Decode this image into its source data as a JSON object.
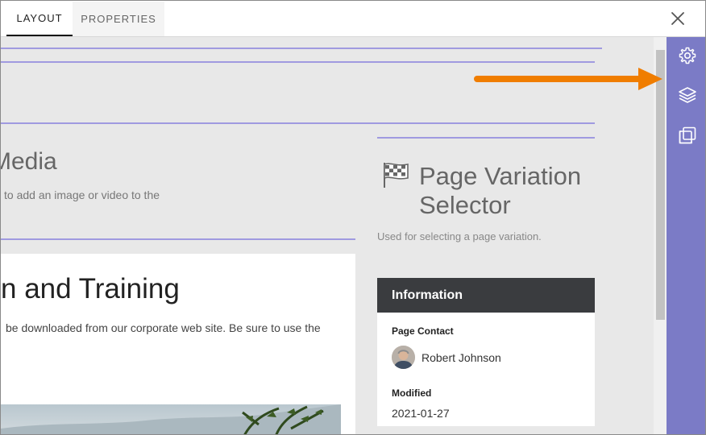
{
  "tabs": [
    {
      "label": "LAYOUT",
      "active": true
    },
    {
      "label": "PROPERTIES",
      "active": false
    }
  ],
  "header": {
    "close_icon": "close-icon"
  },
  "canvas": {
    "media": {
      "title": "Media",
      "description": "to add an image or video to the"
    },
    "page_variation": {
      "icon": "checkered-flag-icon",
      "title": "Page Variation Selector",
      "description": "Used for selecting a page variation."
    },
    "content_card": {
      "title": "n and Training",
      "text": "be downloaded from our corporate web site. Be sure to use the"
    },
    "information": {
      "heading": "Information",
      "page_contact_label": "Page Contact",
      "page_contact_name": "Robert Johnson",
      "modified_label": "Modified",
      "modified_value": "2021-01-27"
    }
  },
  "side_panel": {
    "buttons": [
      "gear-icon",
      "layers-icon",
      "copy-icon"
    ],
    "background": "#7b7bc6"
  },
  "annotation": {
    "arrow_color": "#f07d00",
    "icon": "arrow-right-icon"
  },
  "colors": {
    "guide_line": "#a09ae0",
    "info_header": "#3a3c3f"
  }
}
